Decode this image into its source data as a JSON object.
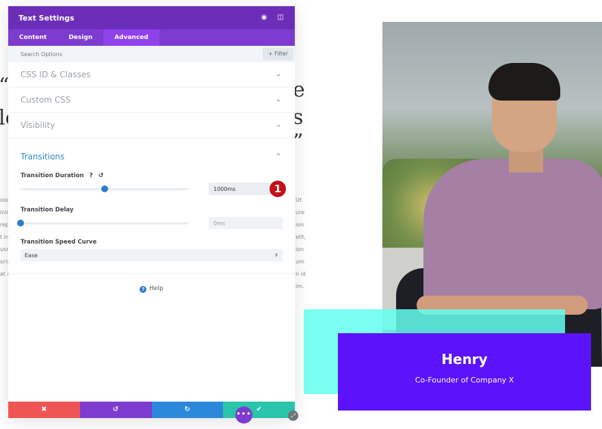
{
  "background": {
    "heading_fragments_right": [
      "e",
      "s",
      "”"
    ],
    "heading_fragments_left": [
      "“",
      "lo"
    ],
    "body_fragments_left": [
      "olo",
      "inii",
      "rep",
      "t in",
      "usr",
      "oris",
      "at r"
    ],
    "body_fragments_right": [
      "Ut",
      "ure",
      "ion",
      "elit,",
      "ion",
      "um",
      "n id",
      "im."
    ],
    "profile": {
      "name": "Henry",
      "role": "Co-Founder of Company X",
      "card_color": "#5c12fa",
      "accent_color": "#64fff0"
    }
  },
  "modal": {
    "title": "Text Settings",
    "header_icons": [
      "focus-icon",
      "sidebar-toggle-icon"
    ],
    "tabs": [
      {
        "label": "Content",
        "active": false
      },
      {
        "label": "Design",
        "active": false
      },
      {
        "label": "Advanced",
        "active": true
      }
    ],
    "search": {
      "placeholder": "Search Options",
      "value": ""
    },
    "filter_label": "+ Filter",
    "sections": [
      {
        "label": "CSS ID & Classes",
        "open": false
      },
      {
        "label": "Custom CSS",
        "open": false
      },
      {
        "label": "Visibility",
        "open": false
      },
      {
        "label": "Transitions",
        "open": true
      }
    ],
    "transitions": {
      "duration": {
        "label": "Transition Duration",
        "value": "1000ms",
        "slider_fraction": 0.5,
        "help_icon": "?",
        "reset_icon": "↺"
      },
      "delay": {
        "label": "Transition Delay",
        "value": "0ms",
        "slider_fraction": 0.0
      },
      "speed_curve": {
        "label": "Transition Speed Curve",
        "selected": "Ease"
      }
    },
    "step_badge": "1",
    "help_label": "Help",
    "footer": {
      "cancel_icon": "✖",
      "undo_icon": "↺",
      "redo_icon": "↻",
      "save_icon": "✔"
    },
    "more_icon": "•••",
    "resize_icon": "⤢",
    "colors": {
      "header": "#6c2eb9",
      "tabs": "#7d3bcf",
      "active_tab": "#8f42ec",
      "accent_blue": "#2e88c0",
      "cancel": "#ef5555",
      "undo": "#7e3bd0",
      "redo": "#2b87da",
      "save": "#29c4a9",
      "badge": "#c3111b"
    }
  }
}
